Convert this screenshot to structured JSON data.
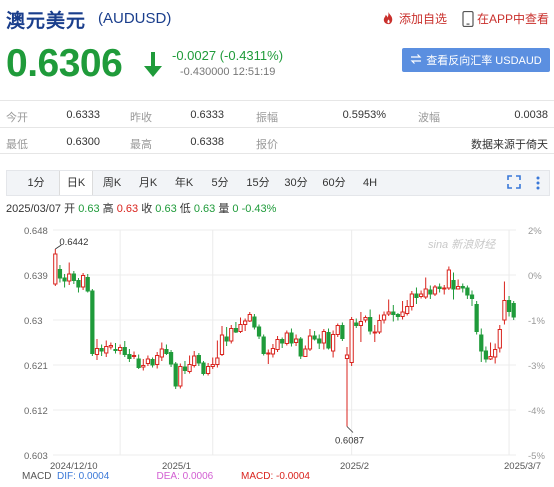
{
  "header": {
    "name": "澳元美元",
    "code": "(AUDUSD)",
    "add_watch": "添加自选",
    "app_view": "在APP中查看"
  },
  "quote": {
    "price": "0.6306",
    "change": "-0.0027 (-0.4311%)",
    "sub_line": "-0.430000 12:51:19",
    "reverse_button": "查看反向汇率 USDAUD"
  },
  "stats": [
    [
      {
        "label": "今开",
        "value": "0.6333"
      },
      {
        "label": "昨收",
        "value": "0.6333"
      },
      {
        "label": "振幅",
        "value": "0.5953%"
      },
      {
        "label": "波幅",
        "value": "0.0038"
      }
    ],
    [
      {
        "label": "最低",
        "value": "0.6300"
      },
      {
        "label": "最高",
        "value": "0.6338"
      },
      {
        "label": "报价",
        "value": ""
      },
      {
        "label": "",
        "value": "数据来源于倚天"
      }
    ]
  ],
  "tabs": [
    "1分",
    "日K",
    "周K",
    "月K",
    "年K",
    "5分",
    "15分",
    "30分",
    "60分",
    "4H"
  ],
  "active_tab": "日K",
  "bar_info": {
    "date": "2025/03/07",
    "open_label": "开",
    "open": "0.63",
    "high_label": "高",
    "high": "0.63",
    "close_label": "收",
    "close": "0.63",
    "low_label": "低",
    "low": "0.63",
    "vol_label": "量",
    "vol": "0",
    "pct": "-0.43%"
  },
  "macd": {
    "label": "MACD",
    "dif": "DIF: 0.0004",
    "dea": "DEA: 0.0006",
    "macd": "MACD: -0.0004"
  },
  "watermark": "sina 新浪财经",
  "colors": {
    "up": "#d9231d",
    "down": "#1f9b3a",
    "brand": "#1a3e8c",
    "accent_button": "#5b8fe0"
  },
  "chart_data": {
    "type": "candlestick",
    "y_ticks_left": [
      "0.648",
      "0.639",
      "0.63",
      "0.621",
      "0.612",
      "0.603"
    ],
    "y_ticks_right": [
      "2%",
      "0%",
      "-1%",
      "-3%",
      "-4%",
      "-5%"
    ],
    "ylim": [
      0.603,
      0.648
    ],
    "x_labels": [
      "2024/12/10",
      "2025/1",
      "2025/2",
      "2025/3/7"
    ],
    "annotations": [
      {
        "label": "0.6442",
        "index": 0,
        "value": 0.6442
      },
      {
        "label": "0.6087",
        "index": 63,
        "value": 0.6087
      }
    ],
    "candles": [
      [
        0.6372,
        0.6432,
        0.6442,
        0.6368
      ],
      [
        0.6401,
        0.6384,
        0.641,
        0.6375
      ],
      [
        0.6384,
        0.6378,
        0.6392,
        0.6365
      ],
      [
        0.6378,
        0.6392,
        0.6415,
        0.637
      ],
      [
        0.6392,
        0.6379,
        0.6398,
        0.6372
      ],
      [
        0.6379,
        0.6366,
        0.6384,
        0.6355
      ],
      [
        0.6366,
        0.6389,
        0.6394,
        0.636
      ],
      [
        0.6385,
        0.6358,
        0.6392,
        0.6355
      ],
      [
        0.6358,
        0.6233,
        0.6362,
        0.6228
      ],
      [
        0.6231,
        0.6243,
        0.6262,
        0.622
      ],
      [
        0.6243,
        0.6238,
        0.6251,
        0.6228
      ],
      [
        0.6234,
        0.6247,
        0.6259,
        0.6226
      ],
      [
        0.6246,
        0.6249,
        0.6255,
        0.6241
      ],
      [
        0.6241,
        0.6239,
        0.6254,
        0.6233
      ],
      [
        0.6239,
        0.6245,
        0.6251,
        0.6231
      ],
      [
        0.6245,
        0.6231,
        0.6258,
        0.6226
      ],
      [
        0.6231,
        0.6223,
        0.6242,
        0.6216
      ],
      [
        0.6228,
        0.6229,
        0.6237,
        0.6222
      ],
      [
        0.6222,
        0.6205,
        0.6231,
        0.6202
      ],
      [
        0.6206,
        0.6209,
        0.6222,
        0.6199
      ],
      [
        0.6213,
        0.6222,
        0.6229,
        0.6208
      ],
      [
        0.6221,
        0.621,
        0.6225,
        0.6205
      ],
      [
        0.6211,
        0.6229,
        0.6236,
        0.6203
      ],
      [
        0.6226,
        0.6242,
        0.6255,
        0.6218
      ],
      [
        0.6241,
        0.6233,
        0.6251,
        0.623
      ],
      [
        0.6235,
        0.6212,
        0.624,
        0.6206
      ],
      [
        0.6212,
        0.6168,
        0.6216,
        0.6162
      ],
      [
        0.6168,
        0.6207,
        0.6213,
        0.6163
      ],
      [
        0.6206,
        0.6199,
        0.6218,
        0.6192
      ],
      [
        0.6197,
        0.6211,
        0.6229,
        0.6193
      ],
      [
        0.6209,
        0.6228,
        0.6238,
        0.6205
      ],
      [
        0.6229,
        0.6214,
        0.6234,
        0.6208
      ],
      [
        0.6214,
        0.6193,
        0.6218,
        0.6189
      ],
      [
        0.6193,
        0.6207,
        0.6214,
        0.6189
      ],
      [
        0.6207,
        0.6211,
        0.6225,
        0.6202
      ],
      [
        0.6211,
        0.6224,
        0.6259,
        0.6205
      ],
      [
        0.6231,
        0.627,
        0.6288,
        0.6228
      ],
      [
        0.6266,
        0.6258,
        0.6286,
        0.6248
      ],
      [
        0.6258,
        0.6283,
        0.629,
        0.6253
      ],
      [
        0.6283,
        0.6276,
        0.6296,
        0.6274
      ],
      [
        0.6277,
        0.6291,
        0.6305,
        0.6274
      ],
      [
        0.6291,
        0.6298,
        0.6303,
        0.6278
      ],
      [
        0.6298,
        0.6311,
        0.6316,
        0.6296
      ],
      [
        0.6306,
        0.6286,
        0.6312,
        0.6281
      ],
      [
        0.6286,
        0.6268,
        0.6291,
        0.6262
      ],
      [
        0.6266,
        0.6233,
        0.6271,
        0.6229
      ],
      [
        0.6233,
        0.6234,
        0.6241,
        0.6212
      ],
      [
        0.6232,
        0.6243,
        0.6252,
        0.6225
      ],
      [
        0.6241,
        0.6261,
        0.6268,
        0.6236
      ],
      [
        0.6261,
        0.6254,
        0.6265,
        0.6244
      ],
      [
        0.6253,
        0.6274,
        0.6279,
        0.6249
      ],
      [
        0.6274,
        0.6254,
        0.6283,
        0.6247
      ],
      [
        0.6255,
        0.6262,
        0.6271,
        0.6248
      ],
      [
        0.6262,
        0.6228,
        0.6266,
        0.6222
      ],
      [
        0.6227,
        0.6242,
        0.6249,
        0.6226
      ],
      [
        0.6242,
        0.6268,
        0.6282,
        0.6238
      ],
      [
        0.6268,
        0.6262,
        0.6278,
        0.6259
      ],
      [
        0.6262,
        0.6254,
        0.6271,
        0.6242
      ],
      [
        0.6254,
        0.6277,
        0.6282,
        0.6241
      ],
      [
        0.6275,
        0.6244,
        0.6283,
        0.6241
      ],
      [
        0.6238,
        0.6271,
        0.6279,
        0.6225
      ],
      [
        0.6271,
        0.6289,
        0.6293,
        0.6266
      ],
      [
        0.6289,
        0.6263,
        0.6295,
        0.6258
      ],
      [
        0.6223,
        0.623,
        0.6246,
        0.6087
      ],
      [
        0.6215,
        0.6301,
        0.6306,
        0.6208
      ],
      [
        0.6294,
        0.6289,
        0.6303,
        0.6284
      ],
      [
        0.6289,
        0.6297,
        0.6316,
        0.6256
      ],
      [
        0.63,
        0.6305,
        0.6309,
        0.6295
      ],
      [
        0.6305,
        0.6278,
        0.6321,
        0.6271
      ],
      [
        0.6274,
        0.6276,
        0.629,
        0.6256
      ],
      [
        0.6276,
        0.6299,
        0.6311,
        0.6272
      ],
      [
        0.63,
        0.631,
        0.6317,
        0.6293
      ],
      [
        0.6312,
        0.6316,
        0.6341,
        0.6308
      ],
      [
        0.6316,
        0.6311,
        0.633,
        0.6297
      ],
      [
        0.6311,
        0.6307,
        0.6314,
        0.6299
      ],
      [
        0.6307,
        0.6316,
        0.6338,
        0.6301
      ],
      [
        0.6313,
        0.6327,
        0.634,
        0.6309
      ],
      [
        0.6327,
        0.6352,
        0.6358,
        0.6319
      ],
      [
        0.6352,
        0.6345,
        0.6365,
        0.6332
      ],
      [
        0.6347,
        0.6352,
        0.6359,
        0.6343
      ],
      [
        0.6346,
        0.6362,
        0.6385,
        0.6342
      ],
      [
        0.636,
        0.6352,
        0.6369,
        0.6342
      ],
      [
        0.6352,
        0.6366,
        0.637,
        0.6348
      ],
      [
        0.6366,
        0.6363,
        0.6373,
        0.6355
      ],
      [
        0.6363,
        0.6364,
        0.637,
        0.6351
      ],
      [
        0.6364,
        0.64,
        0.6407,
        0.636
      ],
      [
        0.6379,
        0.6362,
        0.6395,
        0.6341
      ],
      [
        0.6362,
        0.6367,
        0.6381,
        0.6362
      ],
      [
        0.6367,
        0.6364,
        0.6373,
        0.6355
      ],
      [
        0.6364,
        0.635,
        0.6369,
        0.6342
      ],
      [
        0.635,
        0.6343,
        0.6359,
        0.6328
      ],
      [
        0.6331,
        0.6277,
        0.6338,
        0.6271
      ],
      [
        0.627,
        0.6238,
        0.6283,
        0.6216
      ],
      [
        0.6238,
        0.6222,
        0.6247,
        0.6215
      ],
      [
        0.6222,
        0.6227,
        0.6255,
        0.622
      ],
      [
        0.6226,
        0.6241,
        0.6253,
        0.6213
      ],
      [
        0.6244,
        0.6281,
        0.629,
        0.6235
      ],
      [
        0.63,
        0.6339,
        0.6377,
        0.6291
      ],
      [
        0.6339,
        0.6317,
        0.6348,
        0.6307
      ],
      [
        0.6333,
        0.6306,
        0.6338,
        0.63
      ]
    ]
  }
}
